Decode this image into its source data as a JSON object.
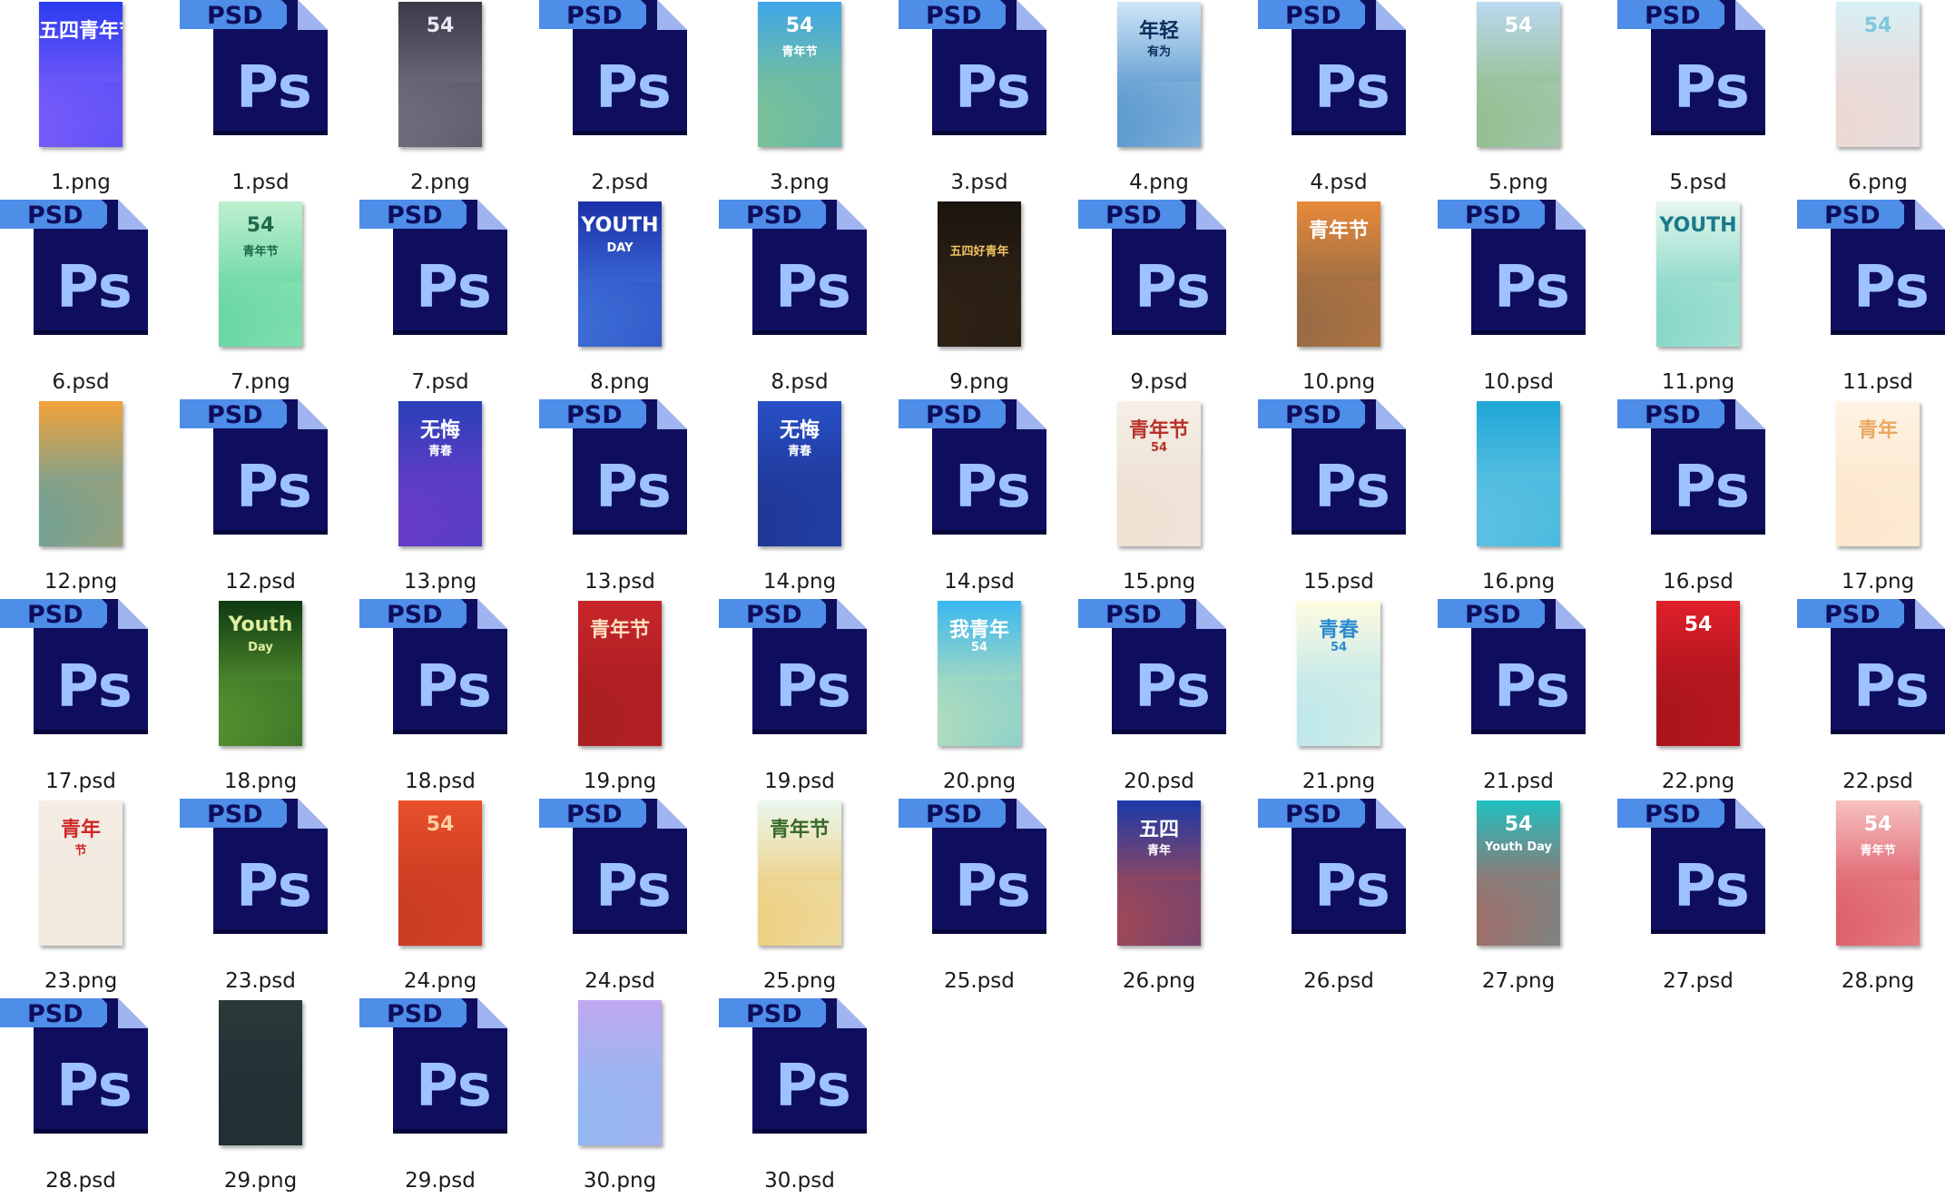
{
  "file_view": {
    "files": [
      {
        "name": "1.png",
        "kind": "png",
        "title": "五四青年节",
        "subtitle": "",
        "bg": [
          "#2b3cf0",
          "#a06cff"
        ],
        "fg": "#ffffff"
      },
      {
        "name": "1.psd",
        "kind": "psd"
      },
      {
        "name": "2.png",
        "kind": "png",
        "title": "54",
        "subtitle": "",
        "bg": [
          "#3a3a4a",
          "#8a8a9a"
        ],
        "fg": "#e8e8f0"
      },
      {
        "name": "2.psd",
        "kind": "psd"
      },
      {
        "name": "3.png",
        "kind": "png",
        "title": "54",
        "subtitle": "青年节",
        "bg": [
          "#3fa6e8",
          "#9ad06a"
        ],
        "fg": "#ffffff"
      },
      {
        "name": "3.psd",
        "kind": "psd"
      },
      {
        "name": "4.png",
        "kind": "png",
        "title": "年轻",
        "subtitle": "有为",
        "bg": [
          "#cfe6f7",
          "#1c6fb8"
        ],
        "fg": "#0d2c5a"
      },
      {
        "name": "4.psd",
        "kind": "psd"
      },
      {
        "name": "5.png",
        "kind": "png",
        "title": "54",
        "subtitle": "",
        "bg": [
          "#bcd9f0",
          "#7fb05a"
        ],
        "fg": "#ffffff"
      },
      {
        "name": "5.psd",
        "kind": "psd"
      },
      {
        "name": "6.png",
        "kind": "png",
        "title": "54",
        "subtitle": "",
        "bg": [
          "#d7f0f6",
          "#f8c9c0"
        ],
        "fg": "#7fc6e0"
      },
      {
        "name": "6.psd",
        "kind": "psd"
      },
      {
        "name": "7.png",
        "kind": "png",
        "title": "54",
        "subtitle": "青年节",
        "bg": [
          "#bff0cf",
          "#38c98a"
        ],
        "fg": "#1d6a4a"
      },
      {
        "name": "7.psd",
        "kind": "psd"
      },
      {
        "name": "8.png",
        "kind": "png",
        "title": "YOUTH",
        "subtitle": "DAY",
        "bg": [
          "#1b2fa8",
          "#4f8ff0"
        ],
        "fg": "#ffffff"
      },
      {
        "name": "8.psd",
        "kind": "psd"
      },
      {
        "name": "9.png",
        "kind": "png",
        "title": "",
        "subtitle": "五四好青年",
        "bg": [
          "#1a140e",
          "#3a2a18"
        ],
        "fg": "#f0c060"
      },
      {
        "name": "9.psd",
        "kind": "psd"
      },
      {
        "name": "10.png",
        "kind": "png",
        "title": "青年节",
        "subtitle": "",
        "bg": [
          "#e8893a",
          "#6a5a4a"
        ],
        "fg": "#ffffff"
      },
      {
        "name": "10.psd",
        "kind": "psd"
      },
      {
        "name": "11.png",
        "kind": "png",
        "title": "YOUTH",
        "subtitle": "",
        "bg": [
          "#e6f6ef",
          "#52c7b0"
        ],
        "fg": "#1a7a8a"
      },
      {
        "name": "11.psd",
        "kind": "psd"
      },
      {
        "name": "12.png",
        "kind": "png",
        "title": "",
        "subtitle": "",
        "bg": [
          "#f2a23a",
          "#2aa0c8"
        ],
        "fg": "#ffffff"
      },
      {
        "name": "12.psd",
        "kind": "psd"
      },
      {
        "name": "13.png",
        "kind": "png",
        "title": "无悔",
        "subtitle": "青春",
        "bg": [
          "#2a40b8",
          "#8a3ad0"
        ],
        "fg": "#ffffff"
      },
      {
        "name": "13.psd",
        "kind": "psd"
      },
      {
        "name": "14.png",
        "kind": "png",
        "title": "无悔",
        "subtitle": "青春",
        "bg": [
          "#2850c8",
          "#1a2a7a"
        ],
        "fg": "#ffffff"
      },
      {
        "name": "14.psd",
        "kind": "psd"
      },
      {
        "name": "15.png",
        "kind": "png",
        "title": "青年节",
        "subtitle": "54",
        "bg": [
          "#f6efe6",
          "#e8d8c8"
        ],
        "fg": "#b8322a"
      },
      {
        "name": "15.psd",
        "kind": "psd"
      },
      {
        "name": "16.png",
        "kind": "png",
        "title": "",
        "subtitle": "",
        "bg": [
          "#1fa7d8",
          "#7fd0e8"
        ],
        "fg": "#ffffff"
      },
      {
        "name": "16.psd",
        "kind": "psd"
      },
      {
        "name": "17.png",
        "kind": "png",
        "title": "青年",
        "subtitle": "",
        "bg": [
          "#fff3e4",
          "#fbe0c0"
        ],
        "fg": "#e8a860"
      },
      {
        "name": "17.psd",
        "kind": "psd"
      },
      {
        "name": "18.png",
        "kind": "png",
        "title": "Youth",
        "subtitle": "Day",
        "bg": [
          "#0f3a12",
          "#7ac040"
        ],
        "fg": "#e0f0a0"
      },
      {
        "name": "18.psd",
        "kind": "psd"
      },
      {
        "name": "19.png",
        "kind": "png",
        "title": "青年节",
        "subtitle": "",
        "bg": [
          "#c8262a",
          "#9a1a1e"
        ],
        "fg": "#ffe0c0"
      },
      {
        "name": "19.psd",
        "kind": "psd"
      },
      {
        "name": "20.png",
        "kind": "png",
        "title": "我青年",
        "subtitle": "54",
        "bg": [
          "#3ab8f0",
          "#f0f0a0"
        ],
        "fg": "#ffffff"
      },
      {
        "name": "20.psd",
        "kind": "psd"
      },
      {
        "name": "21.png",
        "kind": "png",
        "title": "青春",
        "subtitle": "54",
        "bg": [
          "#fffbe0",
          "#9adcf0"
        ],
        "fg": "#2a8ad0"
      },
      {
        "name": "21.psd",
        "kind": "psd"
      },
      {
        "name": "22.png",
        "kind": "png",
        "title": "54",
        "subtitle": "",
        "bg": [
          "#e0202a",
          "#8a0e14"
        ],
        "fg": "#ffffff"
      },
      {
        "name": "22.psd",
        "kind": "psd"
      },
      {
        "name": "23.png",
        "kind": "png",
        "title": "青年",
        "subtitle": "节",
        "bg": [
          "#f4ede4",
          "#efe5da"
        ],
        "fg": "#d0262a"
      },
      {
        "name": "23.psd",
        "kind": "psd"
      },
      {
        "name": "24.png",
        "kind": "png",
        "title": "54",
        "subtitle": "",
        "bg": [
          "#e8502a",
          "#b8301e"
        ],
        "fg": "#ffd0a0"
      },
      {
        "name": "24.psd",
        "kind": "psd"
      },
      {
        "name": "25.png",
        "kind": "png",
        "title": "青年节",
        "subtitle": "",
        "bg": [
          "#eaf8f0",
          "#f0b840"
        ],
        "fg": "#3a6a2a"
      },
      {
        "name": "25.psd",
        "kind": "psd"
      },
      {
        "name": "26.png",
        "kind": "png",
        "title": "五四",
        "subtitle": "青年",
        "bg": [
          "#1a3aa8",
          "#e8502a"
        ],
        "fg": "#ffffff"
      },
      {
        "name": "26.psd",
        "kind": "psd"
      },
      {
        "name": "27.png",
        "kind": "png",
        "title": "54",
        "subtitle": "Youth Day",
        "bg": [
          "#20c0c0",
          "#e8403a"
        ],
        "fg": "#ffffff"
      },
      {
        "name": "27.psd",
        "kind": "psd"
      },
      {
        "name": "28.png",
        "kind": "png",
        "title": "54",
        "subtitle": "青年节",
        "bg": [
          "#f6c0c0",
          "#d02a3a"
        ],
        "fg": "#ffffff"
      },
      {
        "name": "28.psd",
        "kind": "psd"
      },
      {
        "name": "29.png",
        "kind": "png",
        "title": "",
        "subtitle": "",
        "bg": [
          "#2a3a3a",
          "#1a2a30"
        ],
        "fg": "#f0b080"
      },
      {
        "name": "29.psd",
        "kind": "psd"
      },
      {
        "name": "30.png",
        "kind": "png",
        "title": "",
        "subtitle": "",
        "bg": [
          "#c0a8f0",
          "#7ac0f0"
        ],
        "fg": "#2a2a8a"
      },
      {
        "name": "30.psd",
        "kind": "psd"
      }
    ]
  },
  "psd_icon": {
    "badge_text": "PSD",
    "logo_text": "Ps",
    "body_color": "#0f0e5e",
    "body_dark": "#06063a",
    "fold_color": "#9fb4f0",
    "tab_color": "#4e8de8",
    "text_color": "#9ec2ff"
  }
}
